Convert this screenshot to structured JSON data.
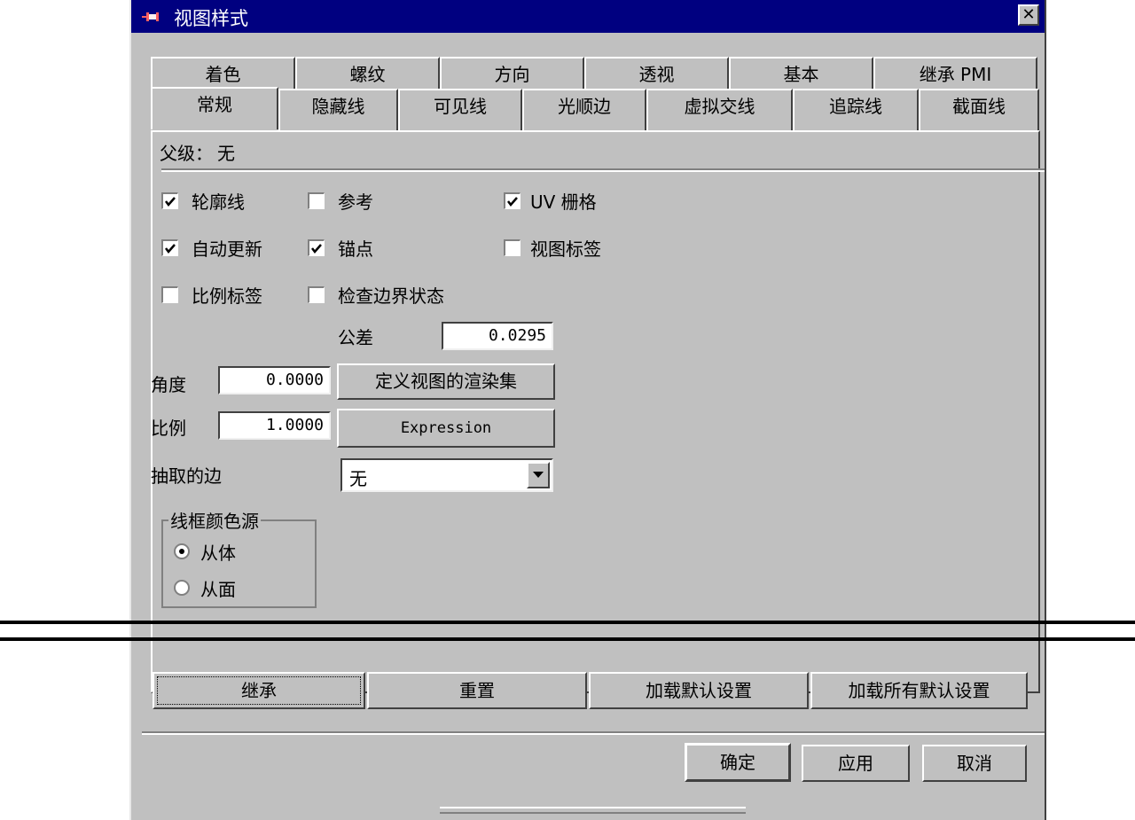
{
  "window": {
    "title": "视图样式",
    "close_glyph": "✕"
  },
  "tabs": {
    "back_row": [
      "着色",
      "螺纹",
      "方向",
      "透视",
      "基本",
      "继承 PMI"
    ],
    "front_row": [
      "常规",
      "隐藏线",
      "可见线",
      "光顺边",
      "虚拟交线",
      "追踪线",
      "截面线"
    ],
    "active": "常规"
  },
  "general": {
    "parent_label": "父级：",
    "parent_value": "无",
    "checkboxes": {
      "silhouettes": {
        "label": "轮廓线",
        "checked": true
      },
      "reference": {
        "label": "参考",
        "checked": false
      },
      "uv_grid": {
        "label": "UV 栅格",
        "checked": true
      },
      "auto_update": {
        "label": "自动更新",
        "checked": true
      },
      "anchor": {
        "label": "锚点",
        "checked": true
      },
      "view_label": {
        "label": "视图标签",
        "checked": false
      },
      "scale_label": {
        "label": "比例标签",
        "checked": false
      },
      "check_boundary": {
        "label": "检查边界状态",
        "checked": false
      }
    },
    "tolerance_label": "公差",
    "tolerance_value": "0.0295",
    "angle_label": "角度",
    "angle_value": "0.0000",
    "render_set_button": "定义视图的渲染集",
    "scale_label_text": "比例",
    "scale_value": "1.0000",
    "expression_button": "Expression",
    "extracted_edges_label": "抽取的边",
    "extracted_edges_value": "无",
    "wireframe_group": {
      "legend": "线框颜色源",
      "options": [
        "从体",
        "从面"
      ],
      "selected": "从体"
    }
  },
  "action_buttons": [
    "继承",
    "重置",
    "加载默认设置",
    "加载所有默认设置"
  ],
  "dialog_buttons": {
    "ok": "确定",
    "apply": "应用",
    "cancel": "取消"
  },
  "colors": {
    "face": "#c0c0c0",
    "titlebar": "#000080"
  }
}
